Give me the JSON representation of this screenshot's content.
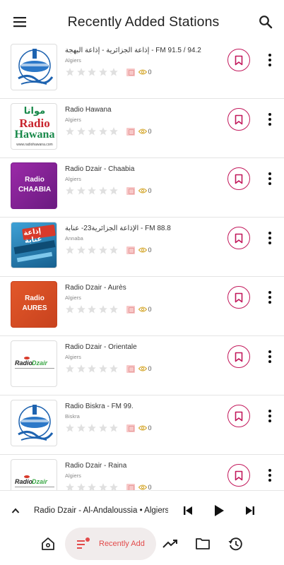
{
  "header": {
    "title": "Recently Added Stations"
  },
  "stations": [
    {
      "name": "إذاعة الجزائرية - إذاعة البهجة - FM 91.5 / 94.2",
      "city": "Algiers",
      "views": "0",
      "logo": "rtm"
    },
    {
      "name": "Radio Hawana",
      "city": "Algiers",
      "views": "0",
      "logo": "hawana"
    },
    {
      "name": "Radio Dzair - Chaabia",
      "city": "Algiers",
      "views": "0",
      "logo": "chaabia"
    },
    {
      "name": "الإذاعة الجزائرية23- عنابة - FM 88.8",
      "city": "Annaba",
      "views": "0",
      "logo": "annaba"
    },
    {
      "name": "Radio Dzair - Aurès",
      "city": "Algiers",
      "views": "0",
      "logo": "aures"
    },
    {
      "name": "Radio Dzair - Orientale",
      "city": "Algiers",
      "views": "0",
      "logo": "dzair"
    },
    {
      "name": "Radio Biskra - FM 99.",
      "city": "Biskra",
      "views": "0",
      "logo": "rtm"
    },
    {
      "name": "Radio Dzair - Raina",
      "city": "Algiers",
      "views": "0",
      "logo": "dzair"
    }
  ],
  "logo_text": {
    "hawana_top": "موانا",
    "hawana_radio": "Radio",
    "hawana_name": "Hawana",
    "hawana_url": "www.radiohawana.com",
    "chaabia_radio": "Radio",
    "chaabia_name": "CHAABIA",
    "aures_radio": "Radio",
    "aures_name": "AURES",
    "dzair_radio": "Radio",
    "dzair_name": "Dzair",
    "annaba_text": "إذاعة عنابة"
  },
  "player": {
    "now_playing": "Radio Dzair - Al-Andaloussia • Algiers"
  },
  "bottom_nav": {
    "active_label": "Recently Add"
  },
  "colors": {
    "accent": "#c2185b",
    "nav_active_text": "#e24b4b",
    "star": "#e0e0e0"
  }
}
